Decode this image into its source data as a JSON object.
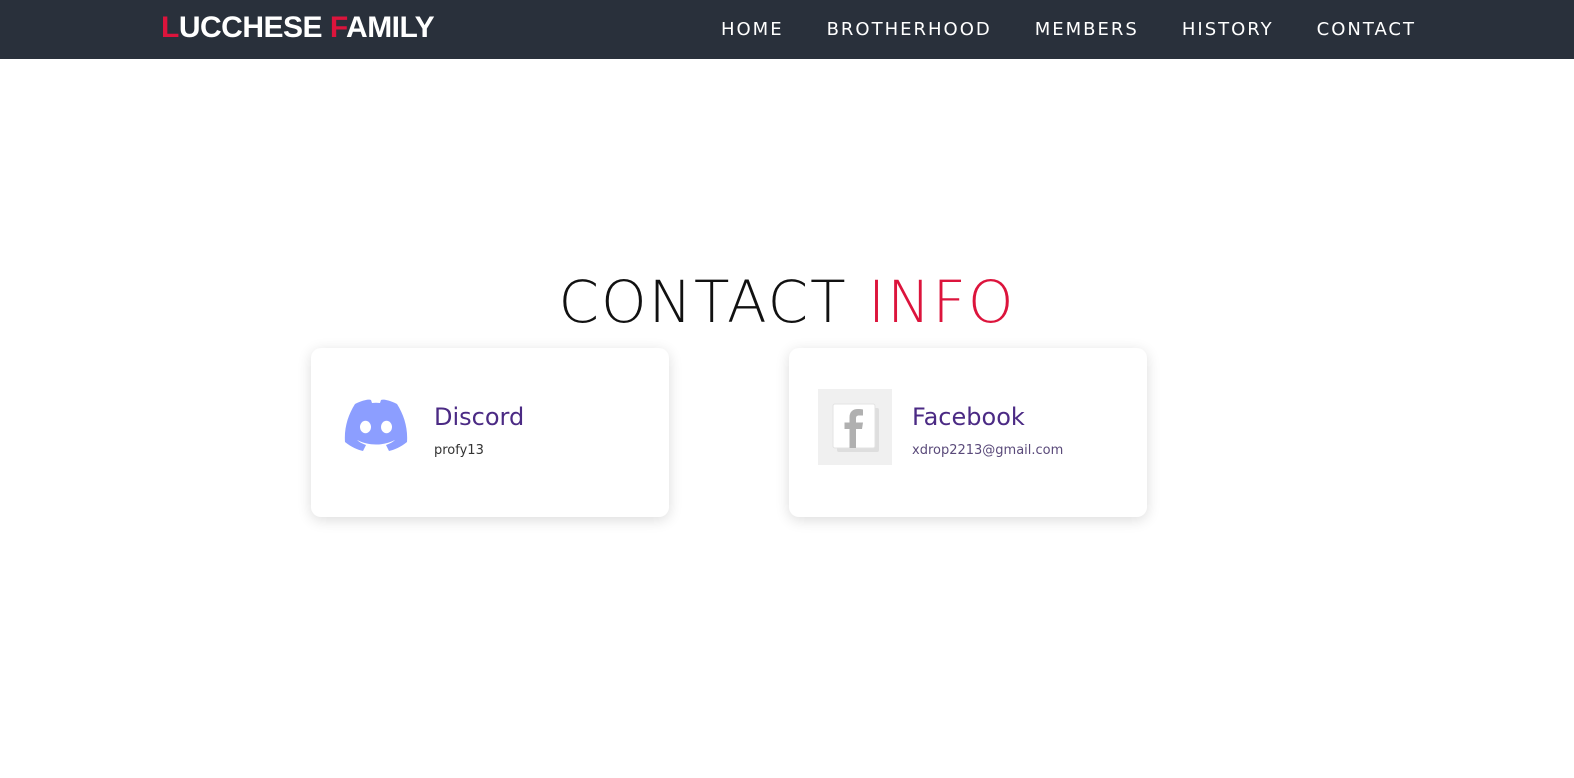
{
  "brand": {
    "initial1": "L",
    "rest1": "UCCHESE ",
    "initial2": "F",
    "rest2": "AMILY"
  },
  "nav": {
    "items": [
      {
        "label": "HOME"
      },
      {
        "label": "BROTHERHOOD"
      },
      {
        "label": "MEMBERS"
      },
      {
        "label": "HISTORY"
      },
      {
        "label": "CONTACT"
      }
    ]
  },
  "section": {
    "title_main": "CONTACT ",
    "title_accent": "INFO"
  },
  "contacts": [
    {
      "name": "Discord",
      "handle": "profy13",
      "icon": "discord-icon"
    },
    {
      "name": "Facebook",
      "handle": "xdrop2213@gmail.com",
      "icon": "facebook-icon"
    }
  ],
  "colors": {
    "navbar_bg": "#29303b",
    "accent": "#dc143c",
    "card_title": "#4b2a84",
    "discord_blurple": "#8c9eff"
  }
}
